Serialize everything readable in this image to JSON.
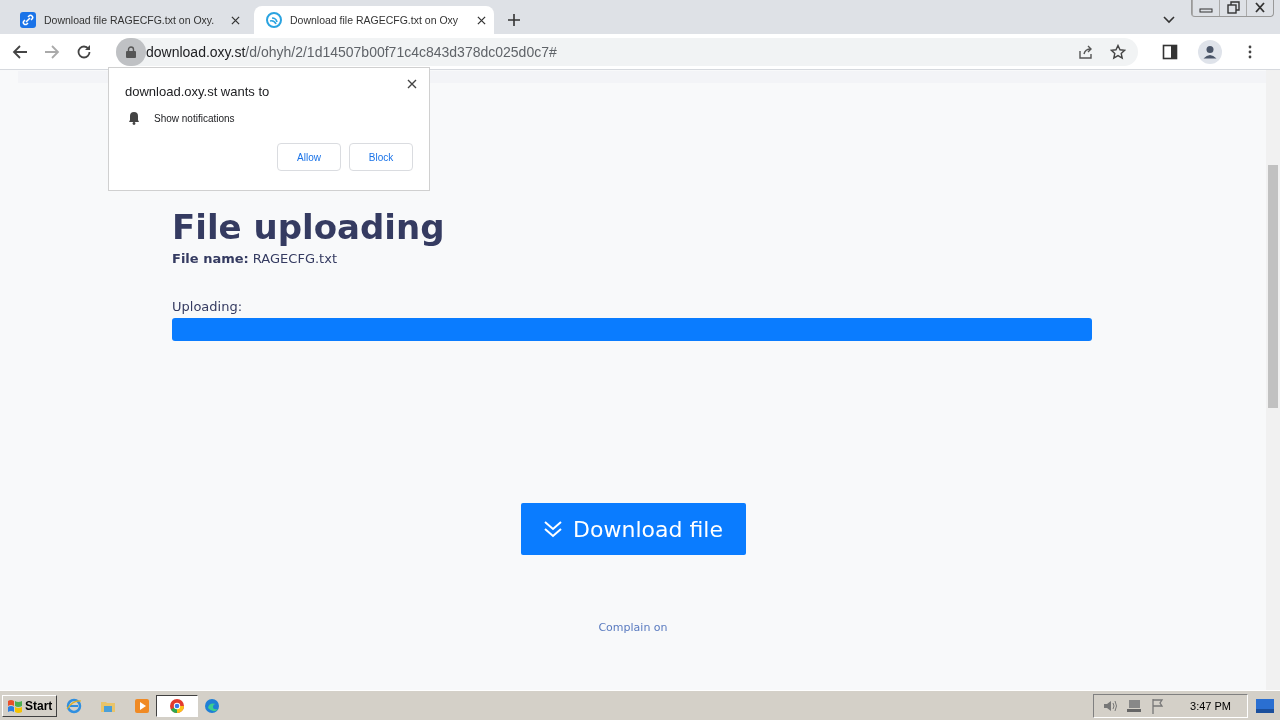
{
  "tabs": [
    {
      "title": "Download file RAGECFG.txt on Oxy.",
      "selected": false
    },
    {
      "title": "Download file RAGECFG.txt on Oxy",
      "selected": true
    }
  ],
  "address_bar": {
    "domain": "download.oxy.st",
    "path": "/d/ohyh/2/1d14507b00f71c4c843d378dc025d0c7#"
  },
  "page": {
    "heading": "File uploading",
    "file_name_label": "File name:",
    "file_name": "RAGECFG.txt",
    "progress_label": "Uploading:",
    "progress": {
      "level": 1
    },
    "download_button": "Download file",
    "complain_link": "Complain on"
  },
  "permission_popup": {
    "title": "download.oxy.st wants to",
    "permission": "Show notifications",
    "buttons": [
      "Allow",
      "Block"
    ]
  },
  "taskbar": {
    "start": "Start",
    "clock": "3:47 PM"
  }
}
